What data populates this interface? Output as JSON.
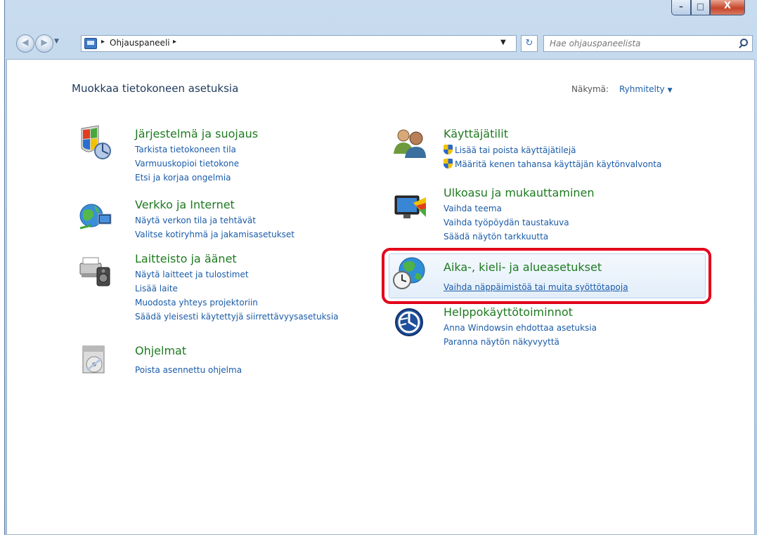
{
  "window": {
    "min_label": "–",
    "max_label": "□",
    "close_label": "X"
  },
  "nav": {
    "back_glyph": "◀",
    "forward_glyph": "▶",
    "history_dropdown": "▼",
    "breadcrumb": "Ohjauspaneeli",
    "breadcrumb_sep": "▸",
    "address_dropdown": "▼",
    "refresh_glyph": "↻",
    "search_placeholder": "Hae ohjauspaneelista"
  },
  "header": {
    "title": "Muokkaa tietokoneen asetuksia",
    "view_label": "Näkymä:",
    "view_value": "Ryhmitelty",
    "view_caret": "▼"
  },
  "categories_left": [
    {
      "title": "Järjestelmä ja suojaus",
      "icon": "system-security-icon",
      "links": [
        "Tarkista tietokoneen tila",
        "Varmuuskopioi tietokone",
        "Etsi ja korjaa ongelmia"
      ]
    },
    {
      "title": "Verkko ja Internet",
      "icon": "network-internet-icon",
      "links": [
        "Näytä verkon tila ja tehtävät",
        "Valitse kotiryhmä ja jakamisasetukset"
      ]
    },
    {
      "title": "Laitteisto ja äänet",
      "icon": "hardware-sound-icon",
      "links": [
        "Näytä laitteet ja tulostimet",
        "Lisää laite",
        "Muodosta yhteys projektoriin",
        "Säädä yleisesti käytettyjä siirrettävyysasetuksia"
      ]
    },
    {
      "title": "Ohjelmat",
      "icon": "programs-icon",
      "links": [
        "Poista asennettu ohjelma"
      ]
    }
  ],
  "categories_right": [
    {
      "title": "Käyttäjätilit",
      "icon": "user-accounts-icon",
      "links": [
        "Lisää tai poista käyttäjätilejä",
        "Määritä kenen tahansa käyttäjän käytönvalvonta"
      ]
    },
    {
      "title": "Ulkoasu ja mukauttaminen",
      "icon": "appearance-icon",
      "links": [
        "Vaihda teema",
        "Vaihda työpöydän taustakuva",
        "Säädä näytön tarkkuutta"
      ]
    },
    {
      "title": "Aika-, kieli- ja alueasetukset",
      "icon": "clock-language-region-icon",
      "links": [
        "Vaihda näppäimistöä tai muita syöttötapoja"
      ]
    },
    {
      "title": "Helppokäyttötoiminnot",
      "icon": "ease-of-access-icon",
      "links": [
        "Anna Windowsin ehdottaa asetuksia",
        "Paranna näytön näkyvyyttä"
      ]
    }
  ],
  "colors": {
    "category_title": "#1e7a20",
    "link": "#1a5ba8",
    "highlight": "#e3001b"
  }
}
